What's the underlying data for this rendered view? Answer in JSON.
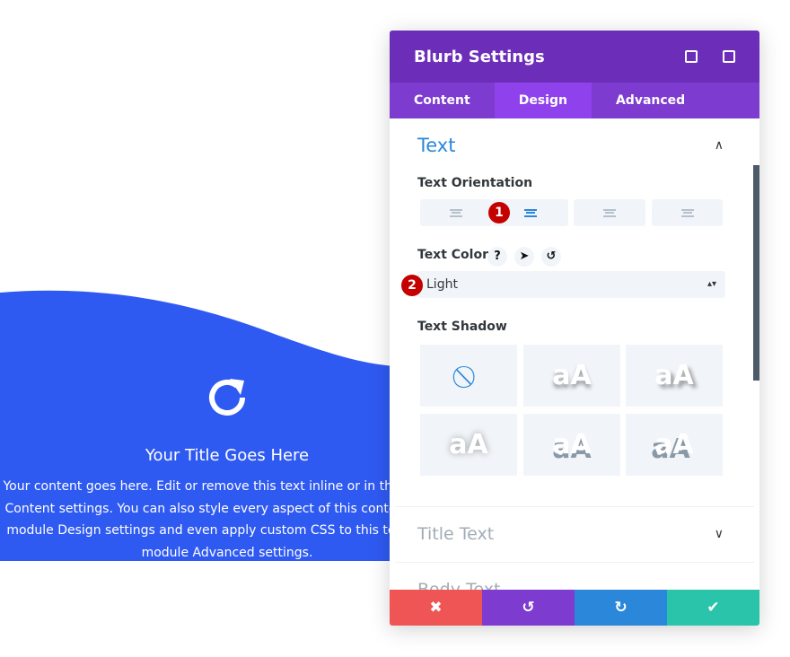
{
  "colors": {
    "section_bg": "#2f5af2",
    "header": "#6c2eb9",
    "tabs": "#7e3bd0",
    "active_tab": "#8f42ec",
    "accent": "#2b87da",
    "cancel": "#ef5555",
    "undo": "#7e3bd0",
    "redo": "#2b87da",
    "save": "#29c4a9",
    "badge": "#c40000"
  },
  "blurb": {
    "icon": "redo-circle-icon",
    "title": "Your Title Goes Here",
    "body": "Your content goes here. Edit or remove this text inline or in the module Content settings. You can also style every aspect of this content in the module Design settings and even apply custom CSS to this text in the module Advanced settings."
  },
  "panel": {
    "title": "Blurb Settings",
    "tabs": [
      {
        "label": "Content"
      },
      {
        "label": "Design",
        "active": true
      },
      {
        "label": "Advanced"
      }
    ],
    "section_title": "Text",
    "text_orientation_label": "Text Orientation",
    "orientation_options": [
      "left",
      "center",
      "right",
      "justify"
    ],
    "orientation_selected": "center",
    "text_color_label": "Text Color",
    "help_glyph": "?",
    "text_color_value": "Light",
    "text_shadow_label": "Text Shadow",
    "shadow_sample": "aA",
    "badges": [
      "1",
      "2"
    ],
    "collapsed_sections": [
      "Title Text",
      "Body Text"
    ]
  }
}
